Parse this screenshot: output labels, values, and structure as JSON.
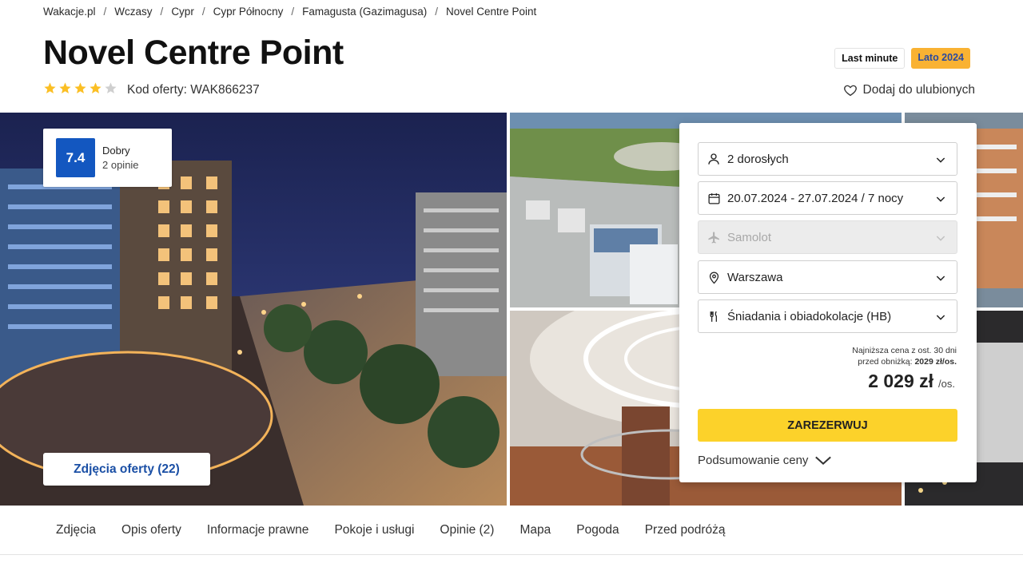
{
  "breadcrumb": [
    "Wakacje.pl",
    "Wczasy",
    "Cypr",
    "Cypr Północny",
    "Famagusta (Gazimagusa)",
    "Novel Centre Point"
  ],
  "hotel": {
    "name": "Novel Centre Point",
    "stars": 4,
    "stars_max": 5,
    "offer_code": "Kod oferty: WAK866237"
  },
  "badges": {
    "last_minute": "Last minute",
    "season": "Lato 2024"
  },
  "favorite_label": "Dodaj do ulubionych",
  "rating": {
    "score": "7.4",
    "label": "Dobry",
    "count": "2 opinie"
  },
  "photos_button": "Zdjęcia oferty (22)",
  "booking": {
    "guests": "2 dorosłych",
    "dates": "20.07.2024 - 27.07.2024 / 7 nocy",
    "transport": "Samolot",
    "departure": "Warszawa",
    "board": "Śniadania i obiadokolacje (HB)",
    "lowest_note_line1": "Najniższa cena z ost. 30 dni",
    "lowest_note_line2_prefix": "przed obniżką: ",
    "lowest_note_value": "2029 zł/os.",
    "price": "2 029 zł",
    "per_person": "/os.",
    "reserve_label": "ZAREZERWUJ",
    "summary_label": "Podsumowanie ceny"
  },
  "tabs": [
    "Zdjęcia",
    "Opis oferty",
    "Informacje prawne",
    "Pokoje i usługi",
    "Opinie (2)",
    "Mapa",
    "Pogoda",
    "Przed podróżą"
  ],
  "colors": {
    "accent_blue": "#1357c0",
    "cta_yellow": "#fcd22a",
    "season_badge": "#f9b233",
    "star": "#fbbf24"
  }
}
